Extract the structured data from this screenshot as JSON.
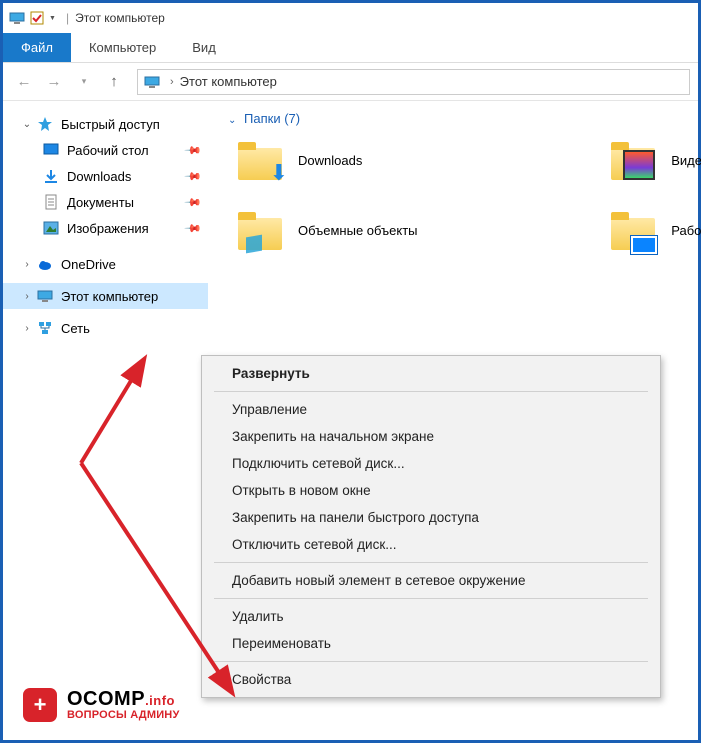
{
  "window": {
    "title": "Этот компьютер"
  },
  "ribbon": {
    "file": "Файл",
    "computer": "Компьютер",
    "view": "Вид"
  },
  "address": {
    "location": "Этот компьютер"
  },
  "sidebar": {
    "quick_access": "Быстрый доступ",
    "items": [
      {
        "label": "Рабочий стол"
      },
      {
        "label": "Downloads"
      },
      {
        "label": "Документы"
      },
      {
        "label": "Изображения"
      }
    ],
    "onedrive": "OneDrive",
    "this_pc": "Этот компьютер",
    "network": "Сеть"
  },
  "main": {
    "folders_header": "Папки (7)",
    "folders": [
      {
        "label": "Downloads"
      },
      {
        "label": "Объемные объекты"
      },
      {
        "label": "Виде"
      },
      {
        "label": "Рабо"
      }
    ]
  },
  "context_menu": {
    "items": [
      {
        "label": "Развернуть",
        "bold": true
      },
      {
        "sep": true
      },
      {
        "label": "Управление"
      },
      {
        "label": "Закрепить на начальном экране"
      },
      {
        "label": "Подключить сетевой диск..."
      },
      {
        "label": "Открыть в новом окне"
      },
      {
        "label": "Закрепить на панели быстрого доступа"
      },
      {
        "label": "Отключить сетевой диск..."
      },
      {
        "sep": true
      },
      {
        "label": "Добавить новый элемент в сетевое окружение"
      },
      {
        "sep": true
      },
      {
        "label": "Удалить"
      },
      {
        "label": "Переименовать"
      },
      {
        "sep": true
      },
      {
        "label": "Свойства"
      }
    ]
  },
  "watermark": {
    "brand": "OCOMP",
    "tld": ".info",
    "sub": "ВОПРОСЫ АДМИНУ"
  }
}
